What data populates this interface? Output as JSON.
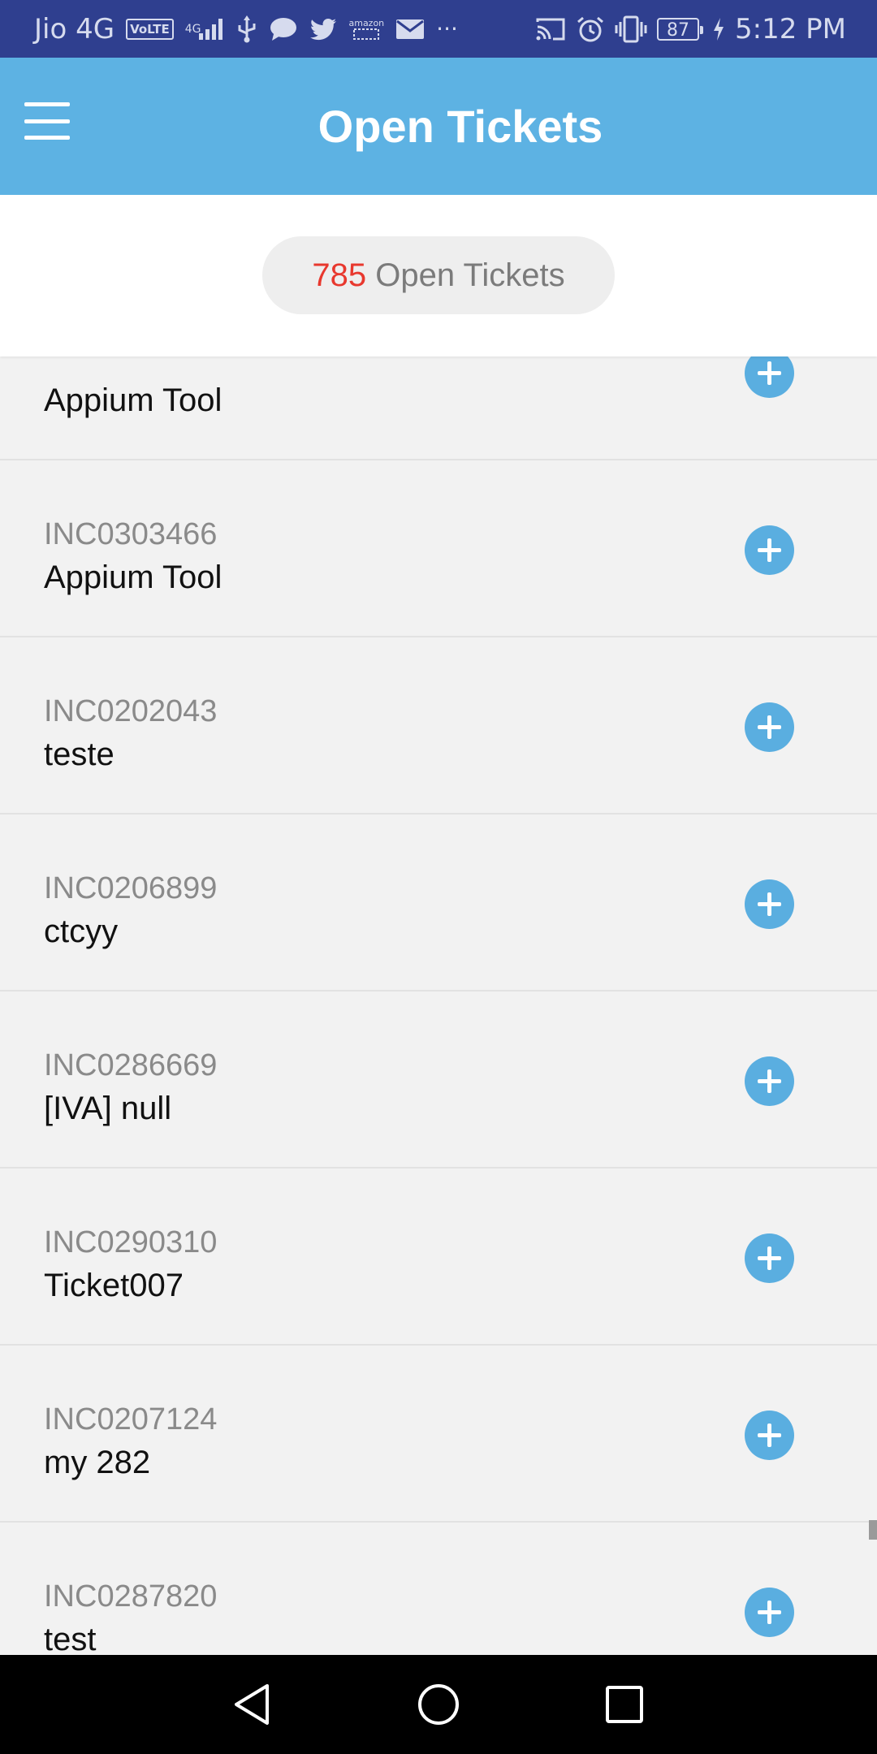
{
  "status_bar": {
    "carrier": "Jio 4G",
    "volte": "VoLTE",
    "network_type": "4G",
    "battery": "87",
    "time": "5:12 PM",
    "more": "···",
    "left_icons": [
      "volte-icon",
      "signal-icon",
      "usb-icon",
      "message-icon",
      "twitter-icon",
      "amazon-icon",
      "mail-icon"
    ],
    "right_icons": [
      "cast-icon",
      "alarm-icon",
      "vibrate-icon",
      "battery-icon",
      "charging-icon"
    ],
    "amazon_label": "amazon"
  },
  "app_bar": {
    "title": "Open Tickets",
    "menu_icon": "hamburger-menu-icon",
    "color": "#5db2e3"
  },
  "summary": {
    "count": "785",
    "label": " Open Tickets",
    "count_color": "#e8382e"
  },
  "tickets": [
    {
      "id": "",
      "description": "Appium Tool"
    },
    {
      "id": "INC0303466",
      "description": "Appium Tool"
    },
    {
      "id": "INC0202043",
      "description": "teste"
    },
    {
      "id": "INC0206899",
      "description": "ctcyy"
    },
    {
      "id": "INC0286669",
      "description": "[IVA] null"
    },
    {
      "id": "INC0290310",
      "description": "Ticket007"
    },
    {
      "id": "INC0207124",
      "description": "my 282"
    },
    {
      "id": "INC0287820",
      "description": "test"
    }
  ],
  "nav_bar": {
    "icons": [
      "back-icon",
      "home-icon",
      "recents-icon"
    ]
  }
}
